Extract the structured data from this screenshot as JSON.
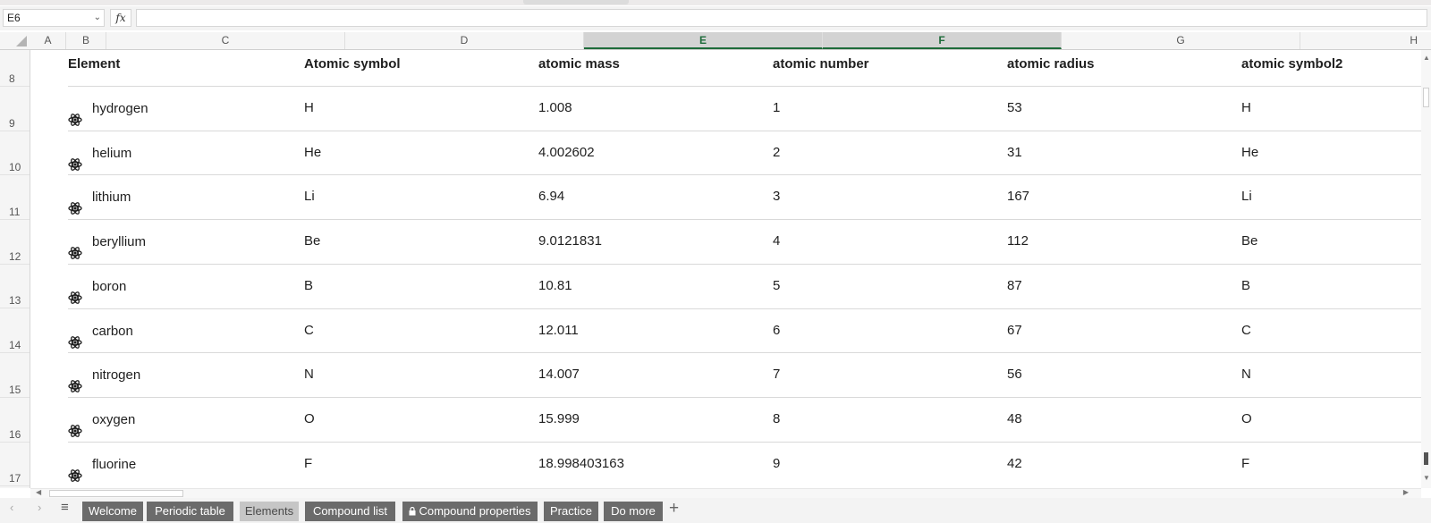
{
  "formula_bar": {
    "name_box": "E6",
    "name_box_chevron": "chevron-down-icon",
    "fx_label": "fx",
    "formula": ""
  },
  "columns": [
    "A",
    "B",
    "C",
    "D",
    "E",
    "F",
    "G",
    "H"
  ],
  "selected_columns": [
    "E",
    "F"
  ],
  "rows": [
    "8",
    "9",
    "10",
    "11",
    "12",
    "13",
    "14",
    "15",
    "16",
    "17"
  ],
  "table": {
    "headers": [
      "Element",
      "Atomic symbol",
      "atomic mass",
      "atomic number",
      "atomic radius",
      "atomic symbol2"
    ],
    "row_icon": "atom-icon",
    "rows": [
      [
        "hydrogen",
        "H",
        "1.008",
        "1",
        "53",
        "H"
      ],
      [
        "helium",
        "He",
        "4.002602",
        "2",
        "31",
        "He"
      ],
      [
        "lithium",
        "Li",
        "6.94",
        "3",
        "167",
        "Li"
      ],
      [
        "beryllium",
        "Be",
        "9.0121831",
        "4",
        "112",
        "Be"
      ],
      [
        "boron",
        "B",
        "10.81",
        "5",
        "87",
        "B"
      ],
      [
        "carbon",
        "C",
        "12.011",
        "6",
        "67",
        "C"
      ],
      [
        "nitrogen",
        "N",
        "14.007",
        "7",
        "56",
        "N"
      ],
      [
        "oxygen",
        "O",
        "15.999",
        "8",
        "48",
        "O"
      ],
      [
        "fluorine",
        "F",
        "18.998403163",
        "9",
        "42",
        "F"
      ]
    ]
  },
  "sheet_tabs": [
    {
      "label": "Welcome"
    },
    {
      "label": "Periodic table"
    },
    {
      "label": "Elements",
      "active": true
    },
    {
      "label": "Compound list"
    },
    {
      "label": "Compound properties",
      "locked": true
    },
    {
      "label": "Practice"
    },
    {
      "label": "Do more"
    }
  ],
  "tab_nav": {
    "prev": "‹",
    "next": "›",
    "menu": "≡",
    "add": "+"
  },
  "colors": {
    "selected_header_text": "#1e6b3a",
    "tab_bg": "#6b6b6b",
    "active_tab_bg": "#c6c6c6"
  }
}
